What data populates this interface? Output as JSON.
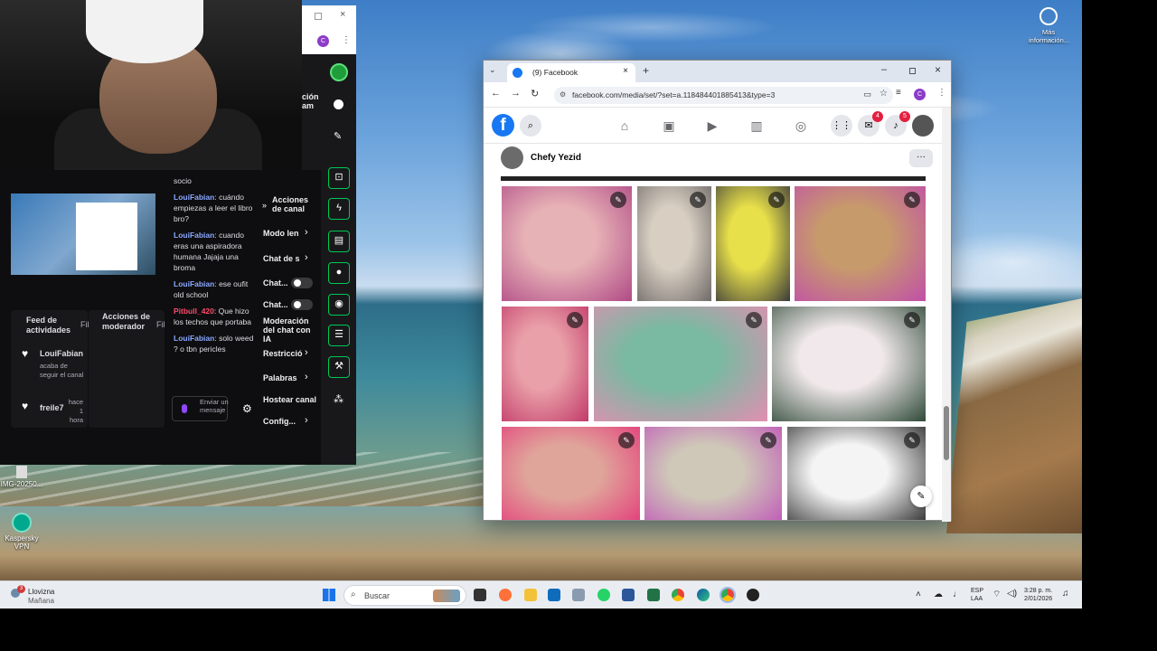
{
  "desktop": {
    "top_right_icon_label": "Más información...",
    "icons": [
      {
        "label": "IMG-20250..."
      },
      {
        "label": "Kaspersky VPN"
      }
    ]
  },
  "dashboard": {
    "activity_feed_title": "Feed de actividades",
    "moderator_actions_title": "Acciones de moderador",
    "filter_label": "Fil",
    "filter_label_2": "Fil",
    "feed": [
      {
        "user": "LouiFabian",
        "text": "acaba de seguir el canal"
      },
      {
        "user": "freile7",
        "time": "hace 1 hora"
      }
    ],
    "chat_top_text": "socio",
    "chat": [
      {
        "user": "LouiFabian",
        "message": ": cuándo empiezas a leer el libro bro?"
      },
      {
        "user": "LouiFabian",
        "message": ": cuando eras una aspiradora humana Jajaja una broma"
      },
      {
        "user": "LouiFabian",
        "message": ": ese oufit old school"
      },
      {
        "user": "Pitbull_420",
        "message": ": Que hizo los techos que portaba"
      },
      {
        "user": "LouiFabian",
        "message": ": solo weed ? o tbn pericles"
      }
    ],
    "chat_input_placeholder": "Enviar un mensaje",
    "channel_actions_title": "Acciones de canal",
    "channel_actions": [
      {
        "label": "Modo len"
      },
      {
        "label": "Chat de s"
      },
      {
        "label": "Chat..."
      },
      {
        "label": "Chat..."
      },
      {
        "label": "Moderación del chat con IA"
      },
      {
        "label": "Restricció"
      },
      {
        "label": "Palabras"
      },
      {
        "label": "Hostear canal"
      },
      {
        "label": "Config..."
      }
    ],
    "header_partial": [
      "ción",
      "am"
    ]
  },
  "browser": {
    "tab_title": "(9) Facebook",
    "url": "facebook.com/media/set/?set=a.118484401885413&type=3",
    "profile_initial": "C",
    "album_owner": "Chefy Yezid",
    "more_label": "···",
    "messenger_badge": "4",
    "notif_badge": "5"
  },
  "photos": [
    {
      "name": "baby-sleeping-pink",
      "colors": [
        "#e7b2b6",
        "#b04a86"
      ]
    },
    {
      "name": "toddler-with-toys",
      "colors": [
        "#d8cfc2",
        "#6f6a68"
      ]
    },
    {
      "name": "toddler-party-hat",
      "colors": [
        "#e8e04a",
        "#3a3a3a"
      ]
    },
    {
      "name": "baby-pink-hood",
      "colors": [
        "#c79a6c",
        "#c14fa8"
      ]
    },
    {
      "name": "baby-smiling-pink",
      "colors": [
        "#e9a0a8",
        "#c23a6a"
      ]
    },
    {
      "name": "baby-on-blanket",
      "colors": [
        "#7ab9a2",
        "#e28fb0"
      ]
    },
    {
      "name": "newborn-blanket",
      "colors": [
        "#f0e8ea",
        "#2f4a38"
      ]
    },
    {
      "name": "baby-close-up",
      "colors": [
        "#e0a59a",
        "#e33a7a"
      ]
    },
    {
      "name": "baby-walker",
      "colors": [
        "#cfc7b8",
        "#c055b8"
      ]
    },
    {
      "name": "man-with-baby",
      "colors": [
        "#f4f4f4",
        "#2a2a2a"
      ]
    }
  ],
  "taskbar": {
    "weather": "Llovizna",
    "weather_sub": "Mañana",
    "weather_badge": "3",
    "search_placeholder": "Buscar",
    "lang": "ESP",
    "lang_sub": "LAA",
    "time": "3:28 p. m.",
    "date": "2/01/2026"
  }
}
